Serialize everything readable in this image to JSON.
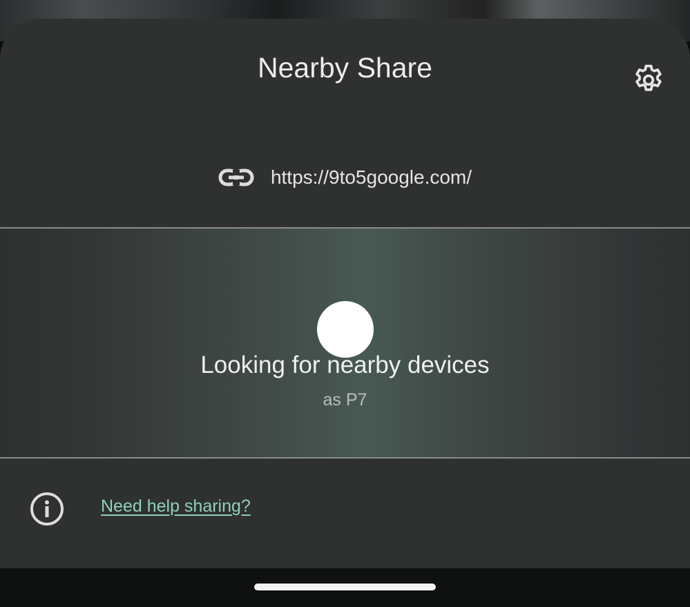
{
  "sheet": {
    "title": "Nearby Share",
    "settings_icon": "gear-icon"
  },
  "share_item": {
    "icon": "link-icon",
    "url": "https://9to5google.com/"
  },
  "scan": {
    "status": "Looking for nearby devices",
    "device_name": "as P7"
  },
  "help": {
    "icon": "info-icon",
    "link_label": "Need help sharing?"
  },
  "colors": {
    "sheet_bg": "#2f3030",
    "accent_link": "#8fd0bd",
    "scan_glow": "#485954"
  }
}
